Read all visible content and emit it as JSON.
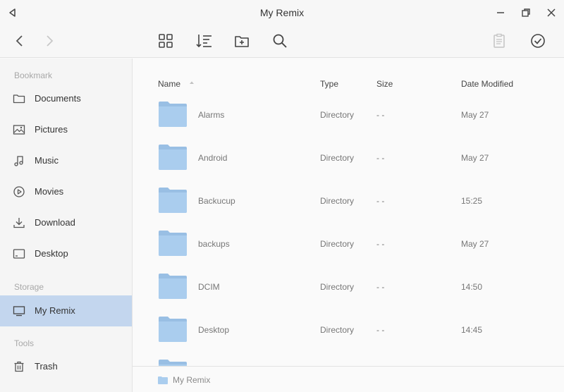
{
  "window": {
    "title": "My Remix"
  },
  "toolbar": {
    "icons": [
      "back-icon",
      "forward-icon",
      "grid-view-icon",
      "sort-icon",
      "new-folder-icon",
      "search-icon",
      "clipboard-icon",
      "check-circle-icon"
    ]
  },
  "sidebar": {
    "sections": {
      "bookmark": "Bookmark",
      "storage": "Storage",
      "tools": "Tools"
    },
    "items": [
      {
        "label": "Documents",
        "icon": "folder-icon"
      },
      {
        "label": "Pictures",
        "icon": "image-icon"
      },
      {
        "label": "Music",
        "icon": "music-note-icon"
      },
      {
        "label": "Movies",
        "icon": "play-circle-icon"
      },
      {
        "label": "Download",
        "icon": "download-icon"
      },
      {
        "label": "Desktop",
        "icon": "desktop-icon"
      },
      {
        "label": "My Remix",
        "icon": "monitor-icon",
        "active": true
      },
      {
        "label": "Trash",
        "icon": "trash-icon"
      }
    ]
  },
  "list": {
    "headers": {
      "name": "Name",
      "type": "Type",
      "size": "Size",
      "date": "Date Modified"
    },
    "rows": [
      {
        "name": "Alarms",
        "type": "Directory",
        "size": "- -",
        "date": "May 27"
      },
      {
        "name": "Android",
        "type": "Directory",
        "size": "- -",
        "date": "May 27"
      },
      {
        "name": "Backucup",
        "type": "Directory",
        "size": "- -",
        "date": "15:25"
      },
      {
        "name": "backups",
        "type": "Directory",
        "size": "- -",
        "date": "May 27"
      },
      {
        "name": "DCIM",
        "type": "Directory",
        "size": "- -",
        "date": "14:50"
      },
      {
        "name": "Desktop",
        "type": "Directory",
        "size": "- -",
        "date": "14:45"
      }
    ]
  },
  "statusbar": {
    "path": "My Remix"
  },
  "colors": {
    "folder": "#aacdee",
    "folder_dark": "#99bfe4",
    "active_item": "#c3d6ee",
    "icon": "#555555"
  }
}
